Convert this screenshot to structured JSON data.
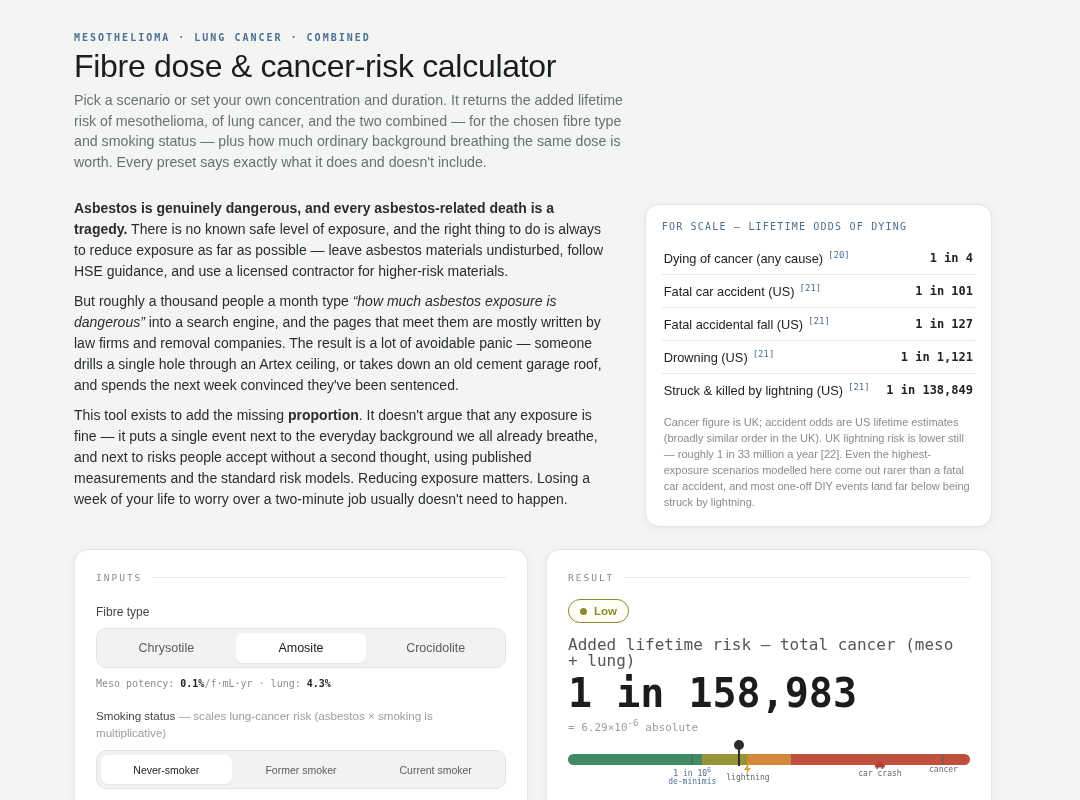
{
  "eyebrow": "MESOTHELIOMA · LUNG CANCER · COMBINED",
  "title": "Fibre dose & cancer-risk calculator",
  "lead": "Pick a scenario or set your own concentration and duration. It returns the added lifetime risk of mesothelioma, of lung cancer, and the two combined — for the chosen fibre type and smoking status — plus how much ordinary background breathing the same dose is worth. Every preset says exactly what it does and doesn't include.",
  "intro": [
    "**Asbestos is genuinely dangerous, and every asbestos-related death is a tragedy.** There is no known safe level of exposure, and the right thing to do is always to reduce exposure as far as possible — leave asbestos materials undisturbed, follow HSE guidance, and use a licensed contractor for higher-risk materials.",
    "But roughly a thousand people a month type *“how much asbestos exposure is dangerous”* into a search engine, and the pages that meet them are mostly written by law firms and removal companies. The result is a lot of avoidable panic — someone drills a single hole through an Artex ceiling, or takes down an old cement garage roof, and spends the next week convinced they've been sentenced.",
    "This tool exists to add the missing **proportion**. It doesn't argue that any exposure is fine — it puts a single event next to the everyday background we all already breathe, and next to risks people accept without a second thought, using published measurements and the standard risk models. Reducing exposure matters. Losing a week of your life to worry over a two-minute job usually doesn't need to happen."
  ],
  "odds": {
    "heading": "FOR SCALE — LIFETIME ODDS OF DYING",
    "rows": [
      {
        "label": "Dying of cancer (any cause)",
        "ref": "[20]",
        "value": "1 in 4"
      },
      {
        "label": "Fatal car accident (US)",
        "ref": "[21]",
        "value": "1 in 101"
      },
      {
        "label": "Fatal accidental fall (US)",
        "ref": "[21]",
        "value": "1 in 127"
      },
      {
        "label": "Drowning (US)",
        "ref": "[21]",
        "value": "1 in 1,121"
      },
      {
        "label": "Struck & killed by lightning (US)",
        "ref": "[21]",
        "value": "1 in 138,849"
      }
    ],
    "note": "Cancer figure is UK; accident odds are US lifetime estimates (broadly similar order in the UK). UK lightning risk is lower still — roughly 1 in 33 million a year [22]. Even the highest-exposure scenarios modelled here come out rarer than a fatal car accident, and most one-off DIY events land far below being struck by lightning."
  },
  "inputs": {
    "heading": "INPUTS",
    "fibre_label": "Fibre type",
    "fibres": [
      {
        "label": "Chrysotile",
        "selected": false
      },
      {
        "label": "Amosite",
        "selected": true
      },
      {
        "label": "Crocidolite",
        "selected": false
      }
    ],
    "potency": "Meso potency: **0.1%**/f·mL·yr · lung: **4.3%**",
    "smoking_label": "Smoking status",
    "smoking_hint": "— scales lung-cancer risk (asbestos × smoking is multiplicative)",
    "smoking": [
      {
        "label": "Never-smoker",
        "selected": true
      },
      {
        "label": "Former smoker",
        "selected": false
      },
      {
        "label": "Current smoker",
        "selected": false
      }
    ]
  },
  "result": {
    "heading": "RESULT",
    "badge": {
      "label": "Low",
      "color": "#8a8a2e"
    },
    "measure": "Added lifetime risk — total cancer (meso + lung)",
    "odds": "1 in 158,983",
    "absolute": "= 6.29×10$^{-6}$ absolute",
    "scale": {
      "level": 0.425,
      "markers": [
        {
          "kind": "tick",
          "label": "1 in 10$^{6}$",
          "sublabel": "de-minimis"
        },
        {
          "kind": "lightning",
          "label": "lightning"
        },
        {
          "kind": "car",
          "label": "car crash"
        },
        {
          "kind": "tick",
          "label": "cancer"
        }
      ]
    }
  }
}
